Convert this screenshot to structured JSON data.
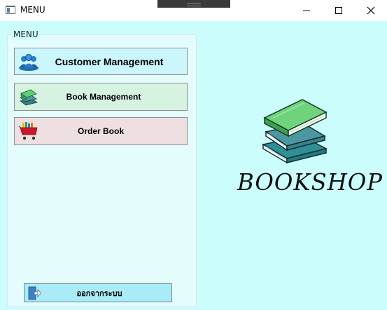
{
  "window": {
    "title": "MENU",
    "controls": [
      "minimize-icon",
      "maximize-icon",
      "close-icon"
    ]
  },
  "menu": {
    "group_title": "MENU",
    "buttons": [
      {
        "label": "Customer Management",
        "icon": "customers-icon",
        "color": "#cbf6fb"
      },
      {
        "label": "Book Management",
        "icon": "books-icon",
        "color": "#d5f3e0"
      },
      {
        "label": "Order Book",
        "icon": "cart-icon",
        "color": "#eee0e2"
      }
    ],
    "exit": {
      "label": "ออกจากระบบ",
      "icon": "logout-icon"
    }
  },
  "brand": {
    "name": "BOOKSHOP",
    "image": "books-stack-icon"
  },
  "colors": {
    "background": "#ccfdfd",
    "exit_button": "#a9ecf7"
  }
}
